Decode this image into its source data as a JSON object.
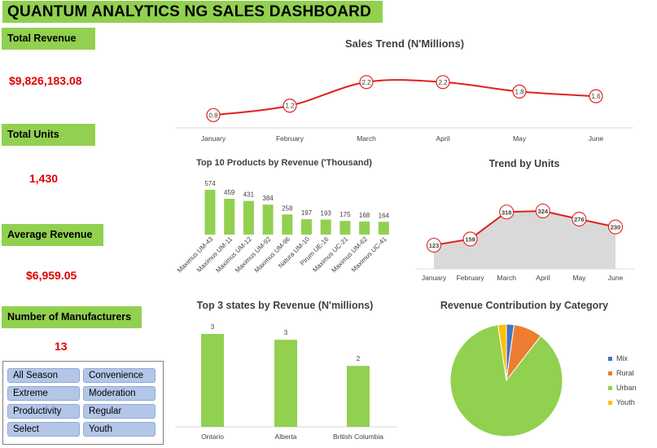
{
  "dashboard": {
    "title": "QUANTUM ANALYTICS NG SALES DASHBOARD"
  },
  "kpis": {
    "total_revenue": {
      "label": "Total Revenue",
      "value": "$9,826,183.08"
    },
    "total_units": {
      "label": "Total Units",
      "value": "1,430"
    },
    "average_revenue": {
      "label": "Average Revenue",
      "value": "$6,959.05"
    },
    "manufacturers": {
      "label": "Number of Manufacturers",
      "value": "13"
    }
  },
  "slicer": {
    "items": [
      "All Season",
      "Convenience",
      "Extreme",
      "Moderation",
      "Productivity",
      "Regular",
      "Select",
      "Youth"
    ]
  },
  "colors": {
    "green": "#92d050",
    "red": "#e00000",
    "trend_red": "#e02020",
    "slicer_blue": "#b4c6e7",
    "area_gray": "#d9d9d9"
  },
  "chart_data": [
    {
      "type": "line",
      "title": "Sales Trend (N'Millions)",
      "categories": [
        "January",
        "February",
        "March",
        "April",
        "May",
        "June"
      ],
      "values": [
        0.8,
        1.2,
        2.2,
        2.2,
        1.8,
        1.6
      ],
      "labels": [
        "0.8",
        "1.2",
        "2.2",
        "2.2",
        "1.8",
        "1.6"
      ],
      "ylim": [
        0.5,
        2.4
      ]
    },
    {
      "type": "bar",
      "title": "Top 10 Products by Revenue ('Thousand)",
      "categories": [
        "Maximus UM-43",
        "Maximus UM-11",
        "Maximus UM-12",
        "Maximus UM-92",
        "Maximus UM-96",
        "Natura UM-10",
        "Pirum UE-16",
        "Maximus UC-21",
        "Maximus UM-62",
        "Maximus UC-41"
      ],
      "values": [
        574,
        459,
        431,
        384,
        258,
        197,
        193,
        175,
        168,
        164
      ],
      "labels": [
        "574",
        "459",
        "431",
        "384",
        "258",
        "197",
        "193",
        "175",
        "168",
        "164"
      ],
      "ylim": [
        0,
        600
      ]
    },
    {
      "type": "area",
      "title": "Trend by Units",
      "categories": [
        "January",
        "February",
        "March",
        "April",
        "May",
        "June"
      ],
      "values": [
        123,
        159,
        318,
        324,
        276,
        230
      ],
      "labels": [
        "123",
        "159",
        "318",
        "324",
        "276",
        "230"
      ],
      "ylim": [
        90,
        360
      ]
    },
    {
      "type": "bar",
      "title": "Top 3 states by Revenue (N'millions)",
      "categories": [
        "Ontario",
        "Alberta",
        "British Columbia"
      ],
      "values": [
        3.2,
        3.0,
        2.1
      ],
      "labels": [
        "3",
        "3",
        "2"
      ],
      "ylim": [
        0,
        3.5
      ]
    },
    {
      "type": "pie",
      "title": "Revenue Contribution by Category",
      "categories": [
        "Mix",
        "Rural",
        "Urban",
        "Youth"
      ],
      "values": [
        2.2,
        8.3,
        87.1,
        2.4
      ],
      "colors": [
        "#4472c4",
        "#ed7d31",
        "#92d050",
        "#ffc000"
      ],
      "legend": "right"
    }
  ]
}
